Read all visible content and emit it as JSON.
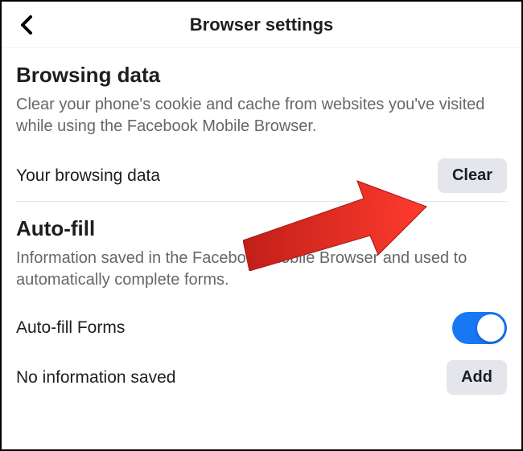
{
  "header": {
    "title": "Browser settings"
  },
  "browsingData": {
    "title": "Browsing data",
    "desc": "Clear your phone's cookie and cache from websites you've visited while using the Facebook Mobile Browser.",
    "rowLabel": "Your browsing data",
    "clearLabel": "Clear"
  },
  "autoFill": {
    "title": "Auto-fill",
    "desc": "Information saved in the Facebook Mobile Browser and used to automatically complete forms.",
    "formsLabel": "Auto-fill Forms",
    "formsEnabled": true,
    "noInfoLabel": "No information saved",
    "addLabel": "Add"
  },
  "annotation": {
    "arrowColor": "#e2231a"
  }
}
